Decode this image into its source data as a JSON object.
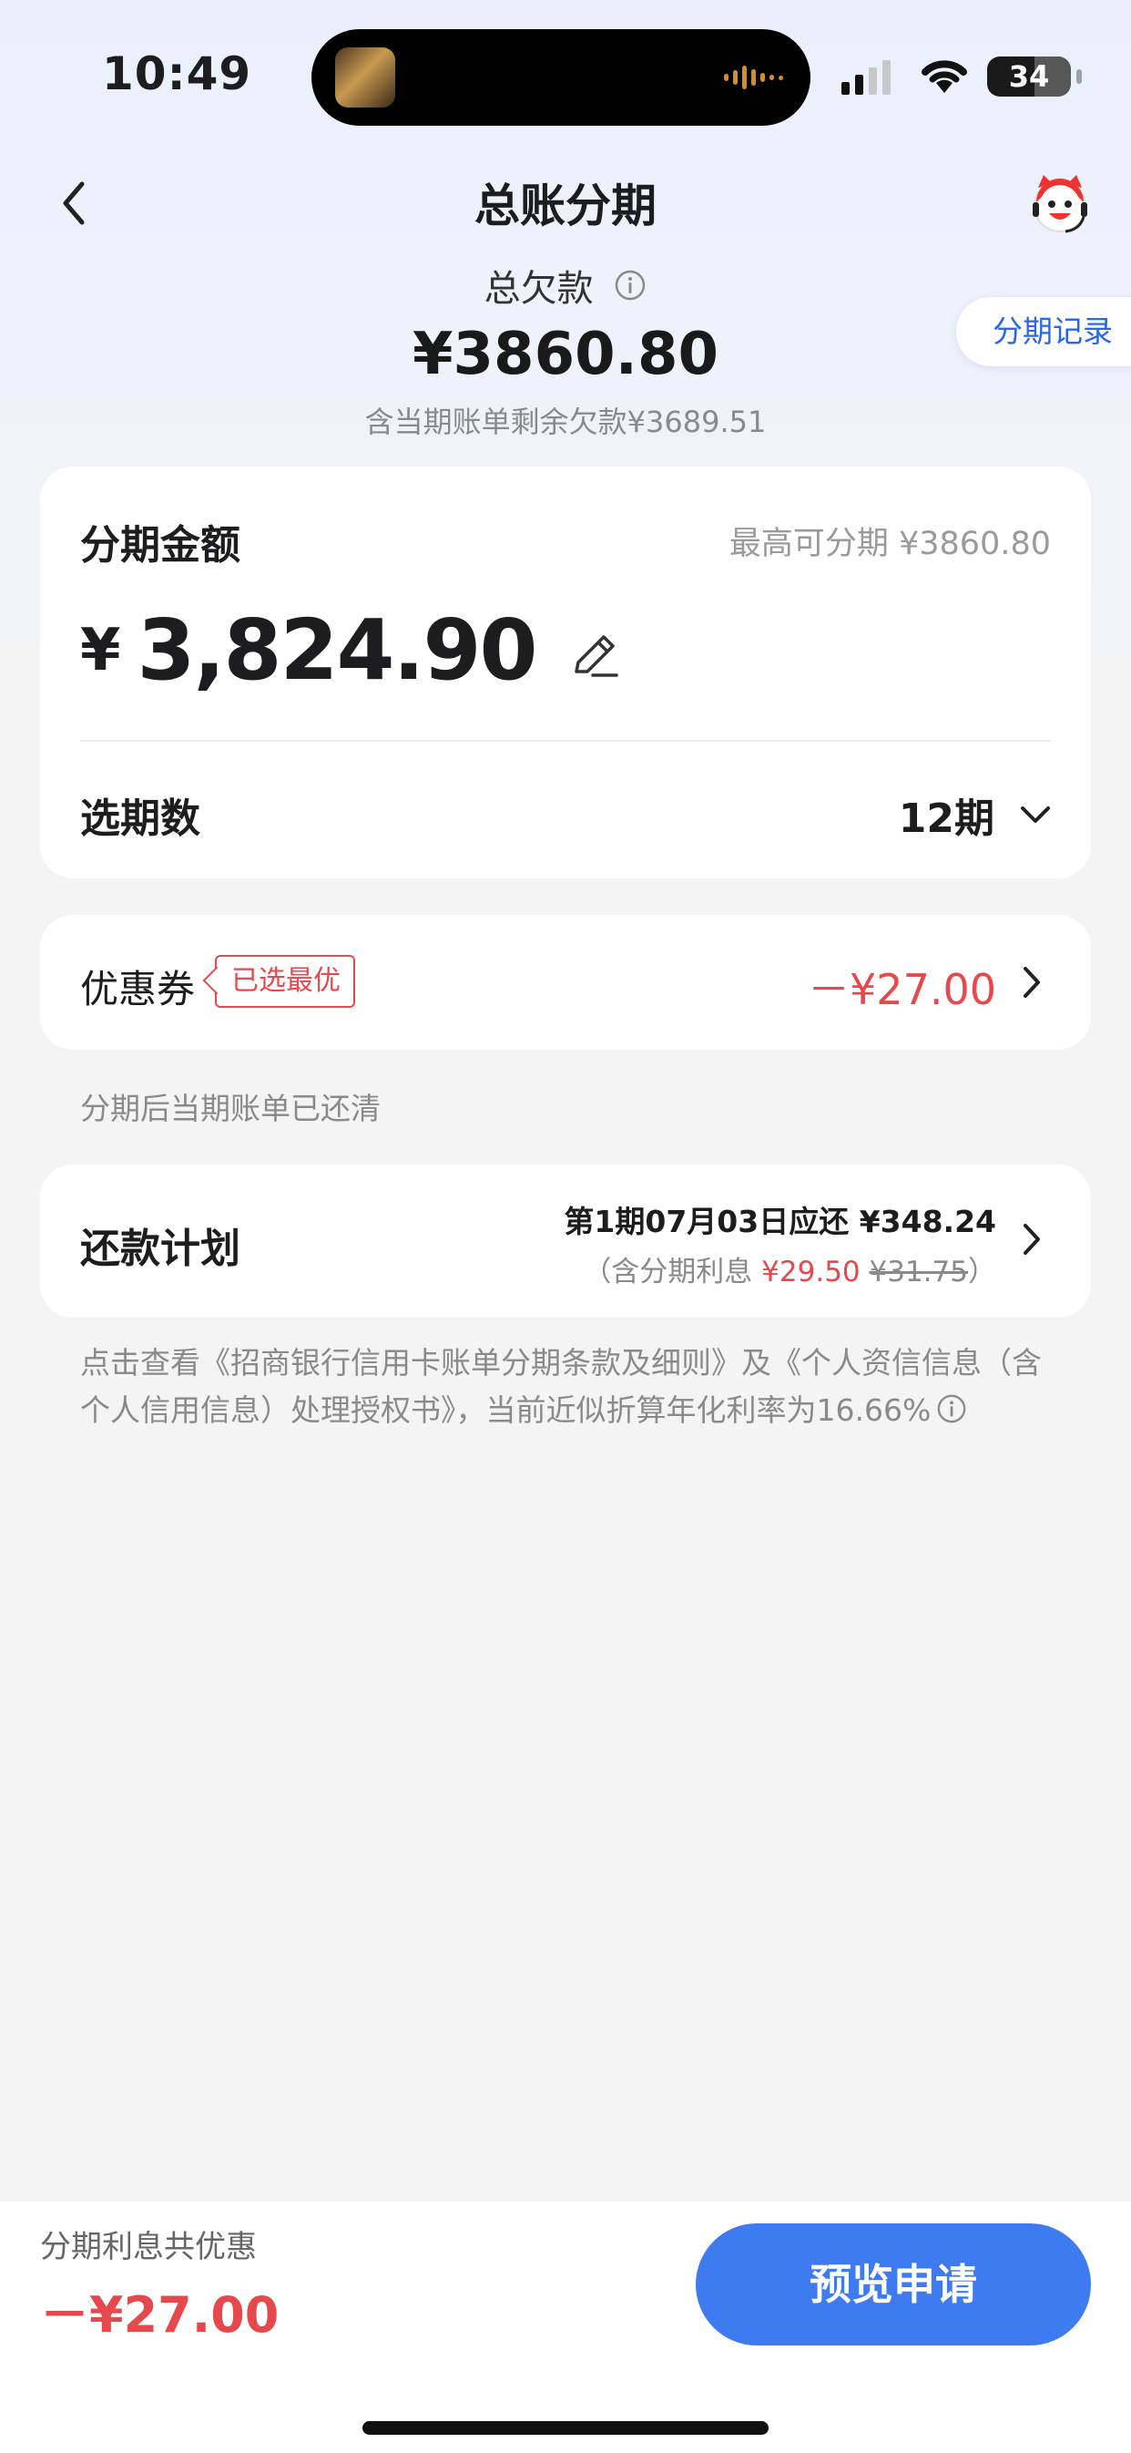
{
  "status_bar": {
    "time": "10:49",
    "battery": "34"
  },
  "nav": {
    "title": "总账分期"
  },
  "summary": {
    "label": "总欠款",
    "amount": "¥3860.80",
    "note": "含当期账单剩余欠款¥3689.51",
    "record_button": "分期记录"
  },
  "installment": {
    "label": "分期金额",
    "max": "最高可分期 ¥3860.80",
    "currency": "¥",
    "amount": "3,824.90",
    "period_label": "选期数",
    "period_value": "12期"
  },
  "coupon": {
    "label": "优惠券",
    "badge": "已选最优",
    "discount": "－¥27.00"
  },
  "after_note": "分期后当期账单已还清",
  "plan": {
    "label": "还款计划",
    "line1": "第1期07月03日应还 ¥348.24",
    "line2_prefix": "（含分期利息 ",
    "interest": "¥29.50",
    "original_interest": "¥31.75",
    "line2_suffix": "）"
  },
  "terms": "点击查看《招商银行信用卡账单分期条款及细则》及《个人资信信息（含个人信用信息）处理授权书》，当前近似折算年化利率为16.66%",
  "bottom": {
    "label": "分期利息共优惠",
    "amount": "－¥27.00",
    "apply_button": "预览申请"
  },
  "colors": {
    "accent": "#3e7af0",
    "discount": "#e5484d",
    "link": "#2b67e6"
  }
}
